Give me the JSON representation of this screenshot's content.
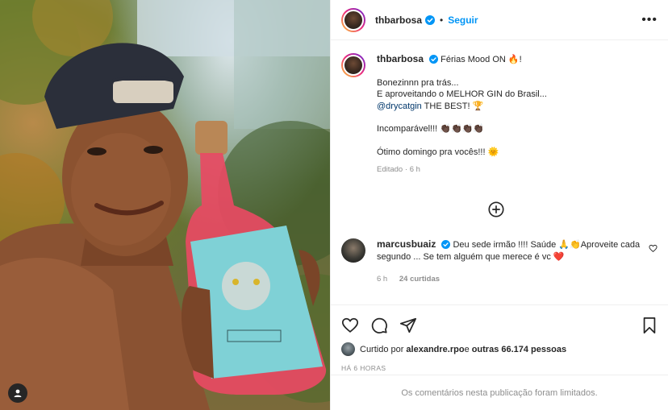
{
  "post": {
    "author": "thbarbosa",
    "separator": "•",
    "follow_label": "Seguir",
    "more_label": "•••"
  },
  "caption": {
    "username": "thbarbosa",
    "line1": "Férias Mood ON 🔥!",
    "line2": "Bonezinnn pra trás...",
    "line3": "E aproveitando o MELHOR GIN do Brasil...",
    "mention": "@drycatgin",
    "line4_suffix": " THE BEST! 🏆",
    "line5": "Incomparável!!! 👏🏿👏🏿👏🏿👏🏿",
    "line6": "Ótimo domingo pra vocês!!! 🌞",
    "edited": "Editado",
    "edited_time": "6 h"
  },
  "comment": {
    "username": "marcusbuaiz",
    "text": " Deu sede irmão !!!! Saúde 🙏👏Aproveite cada segundo ... Se tem alguém que merece é vc ❤️",
    "time": "6 h",
    "likes": "24 curtidas"
  },
  "likes": {
    "prefix": "Curtido por ",
    "user": "alexandre.rpo",
    "middle": " e ",
    "others": "outras 66.174 pessoas"
  },
  "timestamp": "HÁ 6 HORAS",
  "comments_limited": "Os comentários nesta publicação foram limitados.",
  "colors": {
    "accent": "#0095f6",
    "verified": "#0095f6",
    "text": "#262626",
    "muted": "#8e8e8e"
  },
  "icons": [
    "verified-icon",
    "more-icon",
    "plus-circle-icon",
    "heart-icon",
    "comment-icon",
    "share-icon",
    "bookmark-icon",
    "user-tag-icon"
  ]
}
